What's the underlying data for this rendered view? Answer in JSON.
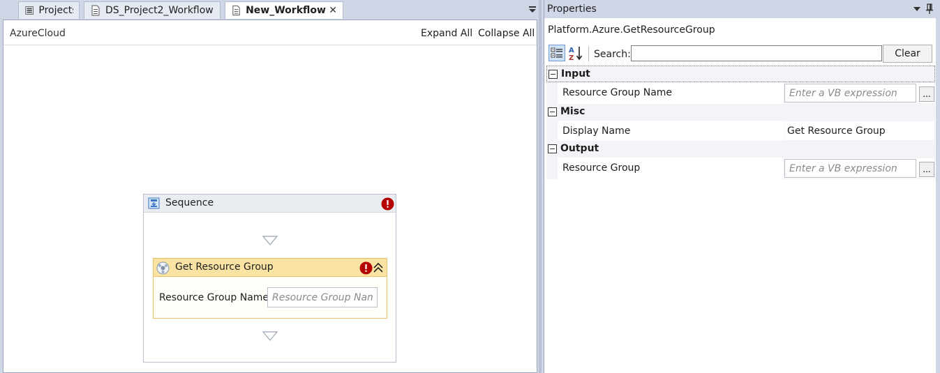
{
  "tabs": [
    {
      "label": "Projects",
      "active": false
    },
    {
      "label": "DS_Project2_Workflow",
      "active": false
    },
    {
      "label": "New_Workflow*",
      "active": true
    }
  ],
  "designer": {
    "breadcrumb": "AzureCloud",
    "expand_all": "Expand All",
    "collapse_all": "Collapse All",
    "sequence": {
      "title": "Sequence",
      "activity": {
        "title": "Get Resource Group",
        "field_label": "Resource Group Name",
        "field_placeholder": "Resource Group Name"
      }
    }
  },
  "properties": {
    "title": "Properties",
    "object_name": "Platform.Azure.GetResourceGroup",
    "search_label": "Search:",
    "search_value": "",
    "clear_label": "Clear",
    "categories": [
      {
        "label": "Input",
        "properties": [
          {
            "name": "Resource Group Name",
            "placeholder": "Enter a VB expression",
            "ellipsis": "..."
          }
        ]
      },
      {
        "label": "Misc",
        "properties": [
          {
            "name": "Display Name",
            "value": "Get Resource Group"
          }
        ]
      },
      {
        "label": "Output",
        "properties": [
          {
            "name": "Resource Group",
            "placeholder": "Enter a VB expression",
            "ellipsis": "..."
          }
        ]
      }
    ]
  },
  "colors": {
    "chrome": "#cfd6e5",
    "activity_header": "#fbe3a4",
    "activity_border": "#e8c26b",
    "error": "#c00000"
  },
  "icons": {
    "projects": "projects-icon",
    "document": "document-icon",
    "close": "close-icon",
    "sequence": "sequence-icon",
    "activity": "azure-activity-icon",
    "error": "error-icon",
    "collapse": "double-chevron-up-icon",
    "pin": "pin-icon",
    "dropdown": "dropdown-arrow-icon"
  }
}
